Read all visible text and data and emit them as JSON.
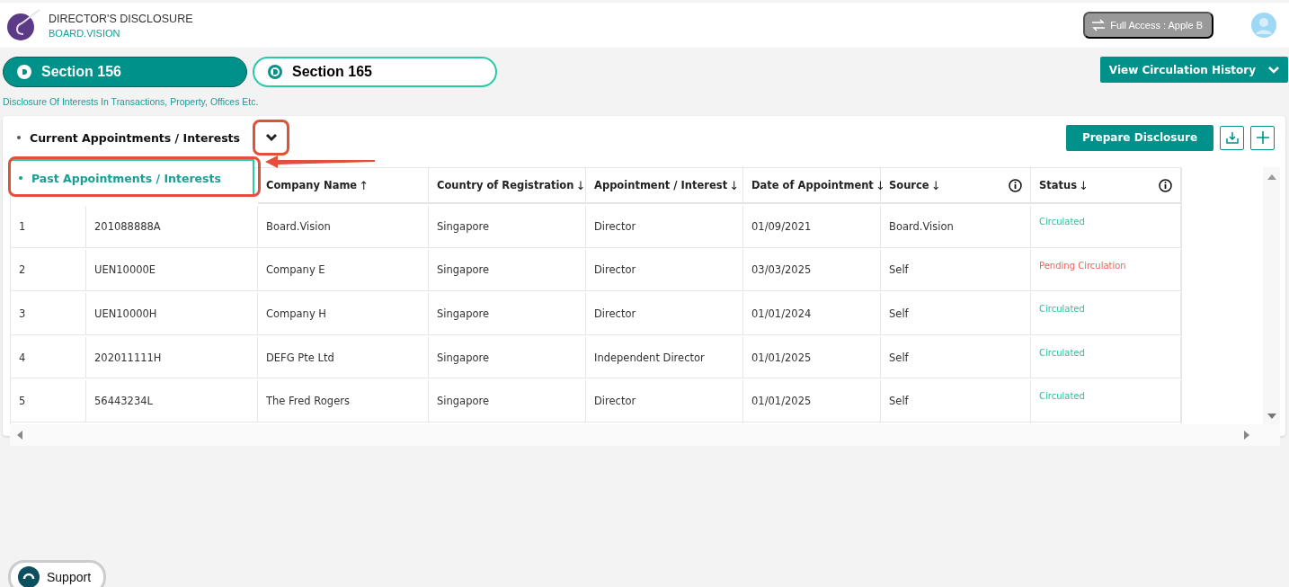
{
  "header": {
    "title": "DIRECTOR'S DISCLOSURE",
    "subtitle": "BOARD.VISION",
    "access_badge": "Full Access : Apple B"
  },
  "tabs": [
    {
      "label": "Section 156",
      "selected": true
    },
    {
      "label": "Section 165",
      "selected": false
    }
  ],
  "tab_description": "Disclosure Of Interests In Transactions, Property, Offices Etc.",
  "circulation_button": "View Circulation History",
  "section_selector": {
    "label": "Current Appointments / Interests",
    "expanded": true
  },
  "dropdown_options": [
    {
      "label": "Past Appointments / Interests"
    }
  ],
  "prepare_button": "Prepare Disclosure",
  "table": {
    "columns": [
      {},
      {},
      {
        "label": "Company Name",
        "sort": "↑",
        "info": false
      },
      {
        "label": "Country of Registration",
        "sort": "↓",
        "info": false
      },
      {
        "label": "Appointment / Interest",
        "sort": "↓",
        "info": false
      },
      {
        "label": "Date of Appointment",
        "sort": "↓",
        "info": false
      },
      {
        "label": "Source",
        "sort": "↓",
        "info": true
      },
      {
        "label": "Status",
        "sort": "↓",
        "info": true
      }
    ],
    "rows": [
      {
        "cells": [
          "1",
          "201088888A",
          "Board.Vision",
          "Singapore",
          "Director",
          "01/09/2021",
          "Board.Vision"
        ],
        "status": {
          "text": "Circulated",
          "color": "#2ebfa0"
        }
      },
      {
        "cells": [
          "2",
          "UEN10000E",
          "Company E",
          "Singapore",
          "Director",
          "03/03/2025",
          "Self"
        ],
        "status": {
          "text": "Pending Circulation",
          "color": "#f0605a"
        }
      },
      {
        "cells": [
          "3",
          "UEN10000H",
          "Company H",
          "Singapore",
          "Director",
          "01/01/2024",
          "Self"
        ],
        "status": {
          "text": "Circulated",
          "color": "#2ebfa0"
        }
      },
      {
        "cells": [
          "4",
          "202011111H",
          "DEFG Pte Ltd",
          "Singapore",
          "Independent Director",
          "01/01/2025",
          "Self"
        ],
        "status": {
          "text": "Circulated",
          "color": "#2ebfa0"
        }
      },
      {
        "cells": [
          "5",
          "56443234L",
          "The Fred Rogers",
          "Singapore",
          "Director",
          "01/01/2025",
          "Self"
        ],
        "status": {
          "text": "Circulated",
          "color": "#2ebfa0"
        }
      }
    ]
  },
  "support_button": "Support"
}
